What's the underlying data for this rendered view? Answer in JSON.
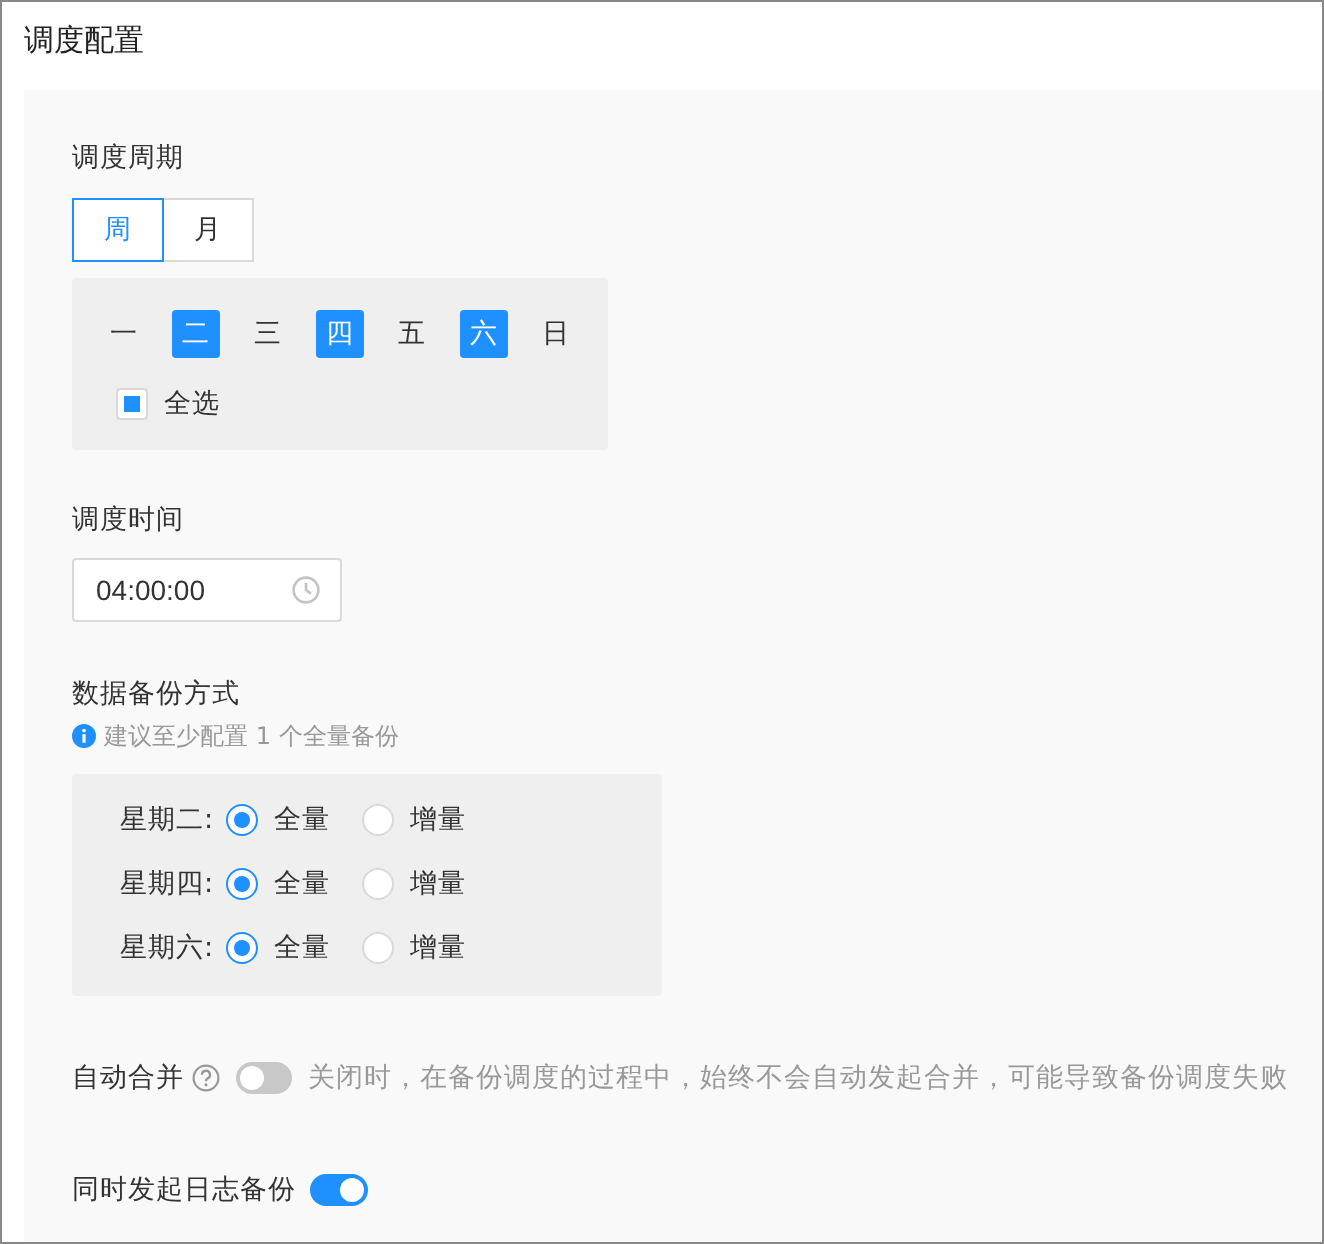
{
  "title": "调度配置",
  "schedule_cycle": {
    "label": "调度周期",
    "modes": [
      {
        "label": "周",
        "selected": true
      },
      {
        "label": "月",
        "selected": false
      }
    ],
    "weekdays": [
      {
        "label": "一",
        "selected": false
      },
      {
        "label": "二",
        "selected": true
      },
      {
        "label": "三",
        "selected": false
      },
      {
        "label": "四",
        "selected": true
      },
      {
        "label": "五",
        "selected": false
      },
      {
        "label": "六",
        "selected": true
      },
      {
        "label": "日",
        "selected": false
      }
    ],
    "select_all": {
      "label": "全选",
      "checked": false,
      "indeterminate": true
    }
  },
  "schedule_time": {
    "label": "调度时间",
    "value": "04:00:00"
  },
  "backup_method": {
    "label": "数据备份方式",
    "hint": "建议至少配置 1 个全量备份",
    "rows": [
      {
        "label": "星期二:",
        "options": [
          {
            "label": "全量",
            "selected": true
          },
          {
            "label": "增量",
            "selected": false
          }
        ]
      },
      {
        "label": "星期四:",
        "options": [
          {
            "label": "全量",
            "selected": true
          },
          {
            "label": "增量",
            "selected": false
          }
        ]
      },
      {
        "label": "星期六:",
        "options": [
          {
            "label": "全量",
            "selected": true
          },
          {
            "label": "增量",
            "selected": false
          }
        ]
      }
    ]
  },
  "auto_merge": {
    "label": "自动合并",
    "on": false,
    "description": "关闭时，在备份调度的过程中，始终不会自动发起合并，可能导致备份调度失败"
  },
  "log_backup": {
    "label": "同时发起日志备份",
    "on": true
  }
}
